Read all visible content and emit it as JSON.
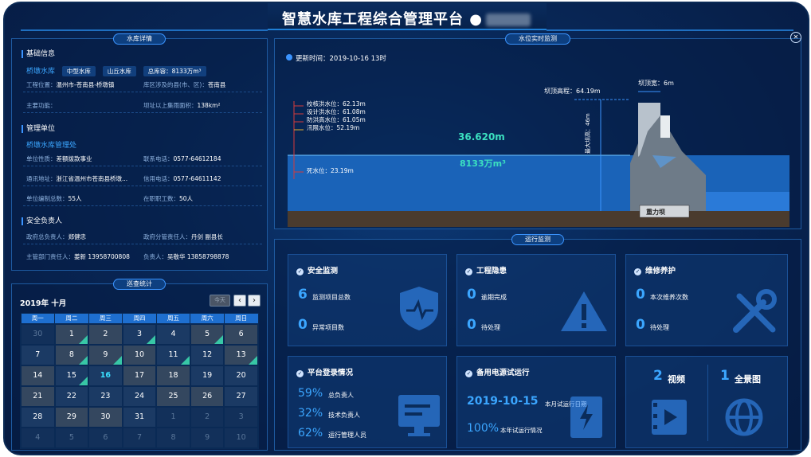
{
  "header": {
    "title": "智慧水库工程综合管理平台 ●"
  },
  "reservoir": {
    "tag": "水库详情",
    "basic": {
      "title": "基础信息",
      "name": "桥墩水库",
      "chips": [
        "中型水库",
        "山丘水库",
        "总库容：8133万m³"
      ],
      "location_label": "工程位置：",
      "location": "温州市-苍南县-桥墩镇",
      "counties_label": "库区涉及的县(市、区)：",
      "counties": "苍南县",
      "func_label": "主要功能：",
      "func": "",
      "area_label": "坝址以上集雨面积：",
      "area": "138km²"
    },
    "mgmt": {
      "title": "管理单位",
      "name": "桥墩水库管理处",
      "nature_label": "单位性质：",
      "nature": "差额拨款事业",
      "phone_label": "联系电话：",
      "phone": "0577-64612184",
      "addr_label": "通讯地址：",
      "addr": "浙江省温州市苍南县桥墩...",
      "fax_label": "信用电话：",
      "fax": "0577-64611142",
      "staff_label": "单位编制总数：",
      "staff": "55人",
      "onjob_label": "在职职工数：",
      "onjob": "50人"
    },
    "safety": {
      "title": "安全负责人",
      "gov_label": "政府总负责人：",
      "gov": "郑健忠",
      "govdiv_label": "政府分管责任人：",
      "govdiv": "丹剑 副县长",
      "dept_label": "主管部门责任人：",
      "dept": "姜新 13958700808",
      "resp_label": "负责人：",
      "resp": "吴敬华 13858798878"
    }
  },
  "waterlevel": {
    "tag": "水位实时监测",
    "update": "更新时间：2019-10-16 13时",
    "levels": [
      "校核洪水位：62.13m",
      "设计洪水位：61.08m",
      "防洪高水位：61.05m",
      "汛限水位：52.19m"
    ],
    "dead": "死水位：23.19m",
    "current": "36.620m",
    "storage": "8133万m³",
    "crest_label": "坝顶高程：64.19m",
    "crest_width": "坝顶宽：6m",
    "max_height": "最大坝高：46m",
    "dam_type": "重力坝"
  },
  "patrol": {
    "tag": "巡查统计",
    "month": "2019年 十月",
    "today_btn": "今天",
    "prev": "‹",
    "next": "›",
    "weekdays": [
      "周一",
      "周二",
      "周三",
      "周四",
      "周五",
      "周六",
      "周日"
    ],
    "weeks": [
      [
        {
          "d": "30",
          "c": "dim"
        },
        {
          "d": "1",
          "c": "g done"
        },
        {
          "d": "2",
          "c": "g"
        },
        {
          "d": "3",
          "c": "done"
        },
        {
          "d": "4",
          "c": ""
        },
        {
          "d": "5",
          "c": "g done"
        },
        {
          "d": "6",
          "c": "g"
        }
      ],
      [
        {
          "d": "7",
          "c": ""
        },
        {
          "d": "8",
          "c": "g done"
        },
        {
          "d": "9",
          "c": "g done"
        },
        {
          "d": "10",
          "c": "g"
        },
        {
          "d": "11",
          "c": "done"
        },
        {
          "d": "12",
          "c": ""
        },
        {
          "d": "13",
          "c": "g done"
        }
      ],
      [
        {
          "d": "14",
          "c": "g"
        },
        {
          "d": "15",
          "c": "done"
        },
        {
          "d": "16",
          "c": "today"
        },
        {
          "d": "17",
          "c": "g"
        },
        {
          "d": "18",
          "c": "g"
        },
        {
          "d": "19",
          "c": ""
        },
        {
          "d": "20",
          "c": ""
        }
      ],
      [
        {
          "d": "21",
          "c": "g"
        },
        {
          "d": "22",
          "c": ""
        },
        {
          "d": "23",
          "c": ""
        },
        {
          "d": "24",
          "c": ""
        },
        {
          "d": "25",
          "c": "g"
        },
        {
          "d": "26",
          "c": "g"
        },
        {
          "d": "27",
          "c": ""
        }
      ],
      [
        {
          "d": "28",
          "c": ""
        },
        {
          "d": "29",
          "c": "g"
        },
        {
          "d": "30",
          "c": "g"
        },
        {
          "d": "31",
          "c": ""
        },
        {
          "d": "1",
          "c": "dim"
        },
        {
          "d": "2",
          "c": "dim"
        },
        {
          "d": "3",
          "c": "dim"
        }
      ],
      [
        {
          "d": "4",
          "c": "dim"
        },
        {
          "d": "5",
          "c": "dim"
        },
        {
          "d": "6",
          "c": "dim"
        },
        {
          "d": "7",
          "c": "dim"
        },
        {
          "d": "8",
          "c": "dim"
        },
        {
          "d": "9",
          "c": "dim"
        },
        {
          "d": "10",
          "c": "dim"
        }
      ]
    ]
  },
  "ops": {
    "tag": "运行监测",
    "safety": {
      "title": "安全监测",
      "n1": "6",
      "l1": "监测项目总数",
      "n2": "0",
      "l2": "异常项目数"
    },
    "hazard": {
      "title": "工程隐患",
      "n1": "0",
      "l1": "逾期完成",
      "n2": "0",
      "l2": "待处理"
    },
    "maint": {
      "title": "维修养护",
      "n1": "0",
      "l1": "本次维养次数",
      "n2": "0",
      "l2": "待处理"
    },
    "login": {
      "title": "平台登录情况",
      "p1": "59%",
      "l1": "总负责人",
      "p2": "32%",
      "l2": "技术负责人",
      "p3": "62%",
      "l3": "运行管理人员"
    },
    "power": {
      "title": "备用电源试运行",
      "date": "2019-10-15",
      "dlabel": "本月试运行日期",
      "pct": "100%",
      "plabel": "本年试运行情况"
    },
    "media": {
      "video_n": "2",
      "video": "视频",
      "pano_n": "1",
      "pano": "全景图"
    }
  }
}
